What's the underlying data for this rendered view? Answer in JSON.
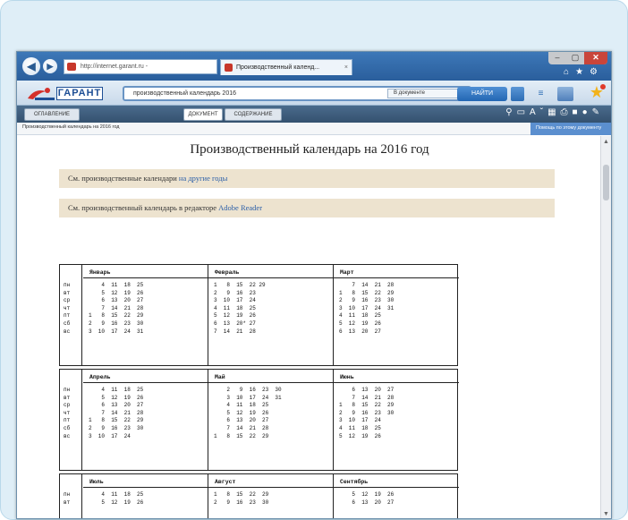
{
  "browser": {
    "address": "http://internet.garant.ru - ",
    "tab_title": "Производственный календ...",
    "tab_close": "×",
    "window_min": "–",
    "window_max": "▢",
    "window_close": "✕"
  },
  "garant": {
    "logo": "ГАРАНТ",
    "search_value": "производственный календарь 2016",
    "scope": "В документе",
    "find_button": "НАЙТИ"
  },
  "tabs": {
    "left": "ОГЛАВЛЕНИЕ",
    "document": "ДОКУМЕНТ",
    "contents": "СОДЕРЖАНИЕ"
  },
  "doc_header": {
    "title": "Производственный календарь на 2016 год",
    "help": "Помощь по этому документу"
  },
  "document": {
    "title": "Производственный календарь на 2016 год",
    "note1_text": "См. производственные календари ",
    "note1_link": "на другие годы",
    "note2_text": "См. производственный календарь в редакторе ",
    "note2_link": "Adobe Reader"
  },
  "calendar": {
    "days": [
      "пн",
      "вт",
      "ср",
      "чт",
      "пт",
      "сб",
      "вс"
    ],
    "quarters": [
      [
        {
          "name": "Январь",
          "weeks": [
            "    4  11  18  25",
            "    5  12  19  26",
            "    6  13  20  27",
            "    7  14  21  28",
            "1   8  15  22  29",
            "2   9  16  23  30",
            "3  10  17  24  31"
          ]
        },
        {
          "name": "Февраль",
          "weeks": [
            "1   8  15  22 29",
            "2   9  16  23",
            "3  10  17  24",
            "4  11  18  25",
            "5  12  19  26",
            "6  13  20* 27",
            "7  14  21  28"
          ]
        },
        {
          "name": "Март",
          "weeks": [
            "    7  14  21  28",
            "1   8  15  22  29",
            "2   9  16  23  30",
            "3  10  17  24  31",
            "4  11  18  25",
            "5  12  19  26",
            "6  13  20  27"
          ]
        }
      ],
      [
        {
          "name": "Апрель",
          "weeks": [
            "    4  11  18  25",
            "    5  12  19  26",
            "    6  13  20  27",
            "    7  14  21  28",
            "1   8  15  22  29",
            "2   9  16  23  30",
            "3  10  17  24"
          ]
        },
        {
          "name": "Май",
          "weeks": [
            "    2   9  16  23  30",
            "    3  10  17  24  31",
            "    4  11  18  25",
            "    5  12  19  26",
            "    6  13  20  27",
            "    7  14  21  28",
            "1   8  15  22  29"
          ]
        },
        {
          "name": "Июнь",
          "weeks": [
            "    6  13  20  27",
            "    7  14  21  28",
            "1   8  15  22  29",
            "2   9  16  23  30",
            "3  10  17  24",
            "4  11  18  25",
            "5  12  19  26"
          ]
        }
      ],
      [
        {
          "name": "Июль",
          "weeks": [
            "    4  11  18  25",
            "    5  12  19  26"
          ]
        },
        {
          "name": "Август",
          "weeks": [
            "1   8  15  22  29",
            "2   9  16  23  30"
          ]
        },
        {
          "name": "Сентябрь",
          "weeks": [
            "    5  12  19  26",
            "    6  13  20  27"
          ]
        }
      ]
    ]
  }
}
